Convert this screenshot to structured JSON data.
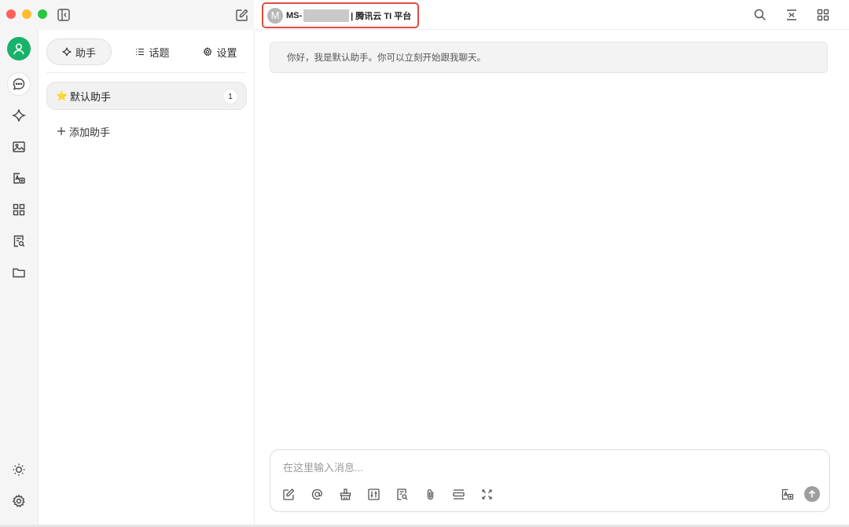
{
  "titlebar": {
    "model": {
      "avatar_letter": "M",
      "name_prefix": "MS-",
      "platform": "| 腾讯云 TI 平台"
    },
    "icons": [
      "sidebar-toggle-icon",
      "new-chat-icon",
      "search-icon",
      "narrow-mode-icon",
      "mini-apps-icon"
    ]
  },
  "rail": {
    "icons": [
      "user-avatar-icon",
      "chat-icon",
      "sparkle-icon",
      "image-icon",
      "translate-icon",
      "apps-grid-icon",
      "knowledge-icon",
      "folder-icon",
      "theme-sun-icon",
      "settings-gear-icon"
    ]
  },
  "sidebar": {
    "tabs": [
      {
        "label": "助手",
        "icon": "sparkle-icon"
      },
      {
        "label": "话题",
        "icon": "list-icon"
      },
      {
        "label": "设置",
        "icon": "gear-icon"
      }
    ],
    "assistants": [
      {
        "emoji": "⭐",
        "name": "默认助手",
        "count": "1"
      }
    ],
    "add_label": "添加助手"
  },
  "chat": {
    "welcome": "你好，我是默认助手。你可以立刻开始跟我聊天。",
    "input_placeholder": "在这里输入消息...",
    "tools": [
      "new-topic-icon",
      "mention-icon",
      "clear-icon",
      "settings-sliders-icon",
      "knowledge-search-icon",
      "attachment-icon",
      "context-icon",
      "expand-icon",
      "translate-input-icon",
      "send-icon"
    ]
  }
}
